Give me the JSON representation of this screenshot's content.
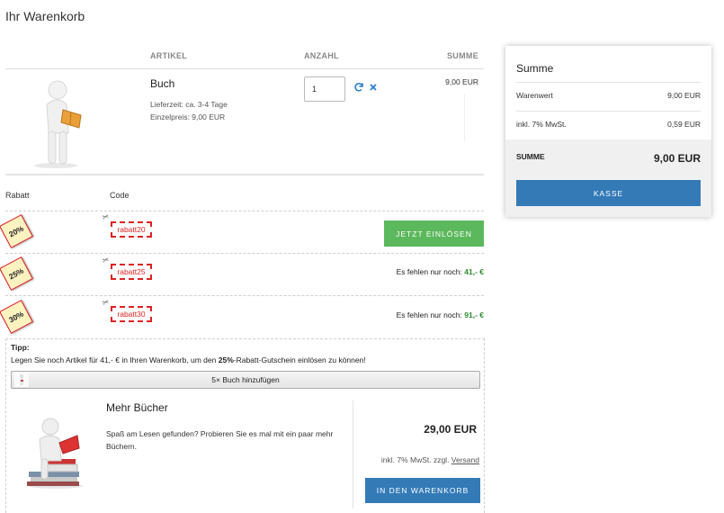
{
  "page": {
    "title": "Ihr Warenkorb"
  },
  "cart": {
    "headers": {
      "article": "ARTIKEL",
      "quantity": "ANZAHL",
      "sum": "SUMME"
    },
    "item": {
      "name": "Buch",
      "delivery": "Lieferzeit: ca. 3-4 Tage",
      "unit_price": "Einzelpreis: 9,00 EUR",
      "quantity": "1",
      "line_total": "9,00 EUR",
      "refresh_icon": "refresh-icon",
      "remove_icon": "close-icon"
    }
  },
  "coupons": {
    "headers": {
      "discount": "Rabatt",
      "code": "Code"
    },
    "rows": [
      {
        "badge": "20%",
        "code": "rabatt20",
        "action": "JETZT EINLÖSEN"
      },
      {
        "badge": "25%",
        "code": "rabatt25",
        "missing_prefix": "Es fehlen nur noch: ",
        "missing_value": "41,- €"
      },
      {
        "badge": "30%",
        "code": "rabatt30",
        "missing_prefix": "Es fehlen nur noch: ",
        "missing_value": "91,- €"
      }
    ]
  },
  "tipp": {
    "label": "Tipp:",
    "text_before": "Legen Sie noch Artikel für 41,- € in Ihren Warenkorb, um den ",
    "text_bold": "25%",
    "text_after": "-Rabatt-Gutschein einlösen zu können!",
    "add_button": "5× Buch hinzufügen"
  },
  "recommendation": {
    "title": "Mehr Bücher",
    "description": "Spaß am Lesen gefunden? Probieren Sie es mal mit ein paar mehr Büchern.",
    "price": "29,00 EUR",
    "tax_note": "inkl. 7% MwSt. zzgl. ",
    "shipping_link": "Versand",
    "cart_button": "IN DEN WARENKORB"
  },
  "summary": {
    "title": "Summe",
    "rows": [
      {
        "label": "Warenwert",
        "value": "9,00 EUR"
      },
      {
        "label": "inkl. 7% MwSt.",
        "value": "0,59 EUR"
      }
    ],
    "total_label": "SUMME",
    "total_value": "9,00 EUR",
    "checkout_button": "KASSE"
  },
  "colors": {
    "primary": "#337ab7",
    "success": "#5cb85c",
    "coupon_red": "#dd2222",
    "missing_green": "#2e8b2e"
  }
}
